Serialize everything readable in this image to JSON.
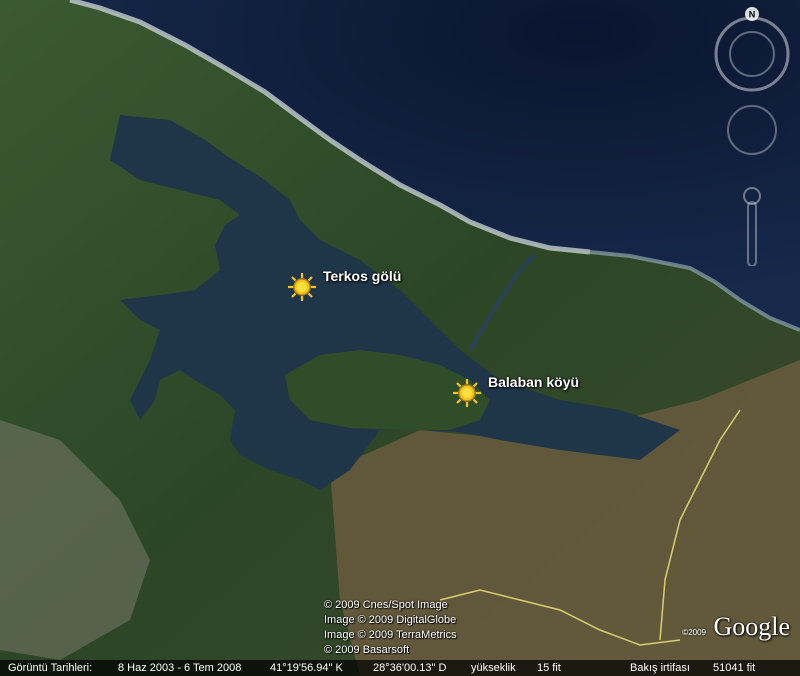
{
  "places": [
    {
      "id": "terkos",
      "label": "Terkos gölü",
      "icon": "sun-placemark-icon"
    },
    {
      "id": "balaban",
      "label": "Balaban köyü",
      "icon": "sun-placemark-icon"
    }
  ],
  "navigation": {
    "north_label": "N"
  },
  "credits": [
    "© 2009 Cnes/Spot Image",
    "Image © 2009 DigitalGlobe",
    "Image © 2009 TerraMetrics",
    "© 2009 Basarsoft"
  ],
  "logo": {
    "text": "Google",
    "year": "©2009"
  },
  "status_bar": {
    "imagery_date_label": "Görüntü Tarihleri:",
    "imagery_date_value": "8 Haz 2003 - 6 Tem 2008",
    "latitude": "41°19'56.94\" K",
    "longitude": "28°36'00.13\" D",
    "elevation_label": "yükseklik",
    "elevation_value": "15 fit",
    "eye_alt_label": "Bakış irtifası",
    "eye_alt_value": "51041 fit"
  },
  "colors": {
    "sea": "#0d1a33",
    "lake": "#1e3347",
    "forest": "#2e4a26",
    "farmland": "#6b5a3a",
    "marker": "#f5c518"
  }
}
